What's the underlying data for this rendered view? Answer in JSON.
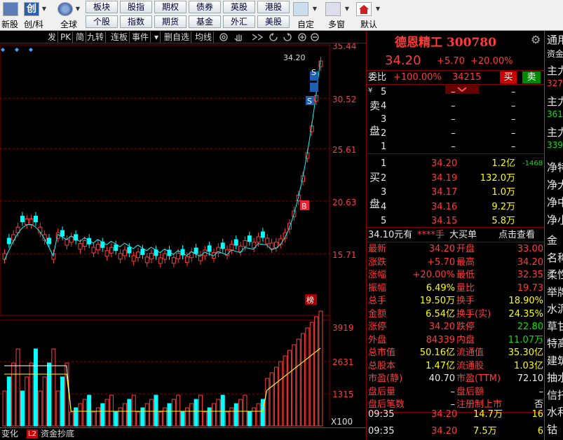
{
  "toolbar": {
    "new_stock": "新股",
    "chuang_ke": "创/科",
    "global": "全球",
    "customize": "自定",
    "multi_window": "多窗",
    "default": "默认",
    "quick_buttons": [
      "板块",
      "股指",
      "期权",
      "债券",
      "英股",
      "港股",
      "个股",
      "指数",
      "期货",
      "基金",
      "外汇",
      "美股"
    ]
  },
  "chart_tabs": [
    "发",
    "PK",
    "简",
    "九转",
    "连板",
    "事件",
    "▾",
    "删自选",
    "均线"
  ],
  "chart": {
    "price_axis": [
      "35.44",
      "30.52",
      "25.61",
      "20.63",
      "15.71"
    ],
    "volume_axis": [
      "3919",
      "2631",
      "1315"
    ],
    "volume_unit": "X100",
    "last_price_tag": "34.20",
    "rank_label": "榜",
    "marker_s": "S",
    "marker_b": "B",
    "colors": {
      "up": "#ff3b3b",
      "down": "#00ffff",
      "ma1": "#ffffff",
      "ma2": "#ffff00",
      "ma3": "#00ffff"
    }
  },
  "bottom_tabs": [
    "变化",
    "L2",
    "资金抄底"
  ],
  "quote": {
    "name": "德恩精工",
    "code": "300780",
    "price": "34.20",
    "change": "+5.70",
    "change_pct": "+20.00%",
    "ratio_label": "委比",
    "ratio": "+100.00%",
    "ratio_vol": "34215",
    "buy_btn": "买",
    "sell_btn": "卖",
    "sell_side_label": [
      "卖",
      "盘"
    ],
    "buy_side_label": [
      "买",
      "盘"
    ],
    "sell_orders": [
      {
        "level": "5",
        "price": "–",
        "vol": "–"
      },
      {
        "level": "4",
        "price": "–",
        "vol": "–"
      },
      {
        "level": "3",
        "price": "–",
        "vol": "–"
      },
      {
        "level": "2",
        "price": "–",
        "vol": "–"
      },
      {
        "level": "1",
        "price": "–",
        "vol": "–"
      }
    ],
    "buy_orders": [
      {
        "level": "1",
        "price": "34.20",
        "vol": "1.2亿",
        "delta": "-1468"
      },
      {
        "level": "2",
        "price": "34.19",
        "vol": "132.0万",
        "delta": ""
      },
      {
        "level": "3",
        "price": "34.17",
        "vol": "1.0万",
        "delta": ""
      },
      {
        "level": "4",
        "price": "34.16",
        "vol": "9.2万",
        "delta": ""
      },
      {
        "level": "5",
        "price": "34.15",
        "vol": "5.8万",
        "delta": ""
      }
    ],
    "bigorder": {
      "price": "34.10元有",
      "hands": "****手",
      "label": "大买单",
      "link": "点击查看"
    },
    "stats_left": [
      {
        "k": "最新",
        "v": "34.20",
        "c": "red"
      },
      {
        "k": "涨跌",
        "v": "+5.70",
        "c": "red"
      },
      {
        "k": "涨幅",
        "v": "+20.00%",
        "c": "red"
      },
      {
        "k": "振幅",
        "v": "6.49%",
        "c": "yellow"
      },
      {
        "k": "总手",
        "v": "19.50万",
        "c": "yellow"
      },
      {
        "k": "金额",
        "v": "6.54亿",
        "c": "yellow"
      },
      {
        "k": "涨停",
        "v": "34.20",
        "c": "red"
      },
      {
        "k": "外盘",
        "v": "84339",
        "c": "red"
      },
      {
        "k": "总市值",
        "v": "50.16亿",
        "c": "yellow"
      },
      {
        "k": "总股本",
        "v": "1.47亿",
        "c": "yellow"
      },
      {
        "k": "市盈(静)",
        "v": "40.70",
        "c": "white"
      },
      {
        "k": "盘后量",
        "v": "–",
        "c": "white"
      },
      {
        "k": "盘后笔数",
        "v": "–",
        "c": "white"
      }
    ],
    "stats_right": [
      {
        "k": "开盘",
        "v": "33.00",
        "c": "red"
      },
      {
        "k": "最高",
        "v": "34.20",
        "c": "red"
      },
      {
        "k": "最低",
        "v": "32.35",
        "c": "red"
      },
      {
        "k": "量比",
        "v": "19.73",
        "c": "red"
      },
      {
        "k": "换手",
        "v": "18.90%",
        "c": "yellow"
      },
      {
        "k": "换手(实)",
        "v": "24.35%",
        "c": "yellow"
      },
      {
        "k": "跌停",
        "v": "22.80",
        "c": "green"
      },
      {
        "k": "内盘",
        "v": "11.07万",
        "c": "green"
      },
      {
        "k": "流通值",
        "v": "35.30亿",
        "c": "yellow"
      },
      {
        "k": "流通股",
        "v": "1.03亿",
        "c": "yellow"
      },
      {
        "k": "市盈(TTM)",
        "v": "72.10",
        "c": "white"
      },
      {
        "k": "盘后额",
        "v": "–",
        "c": "white"
      },
      {
        "k": "注册制上市",
        "v": "否",
        "c": "white"
      }
    ],
    "ticks": [
      {
        "time": "09:35",
        "price": "34.20",
        "vol": "14.7万",
        "n": "16"
      },
      {
        "time": "09:35",
        "price": "34.20",
        "vol": "7.5万",
        "n": "6"
      }
    ]
  },
  "far_right": {
    "top": [
      "通用",
      "资金",
      "主力",
      "327",
      "主力",
      "361",
      "主力",
      "339"
    ],
    "mid": [
      "净特",
      "净大",
      "净中",
      "净小"
    ],
    "list": [
      "金",
      "名称",
      "柔性",
      "举牌",
      "水泥",
      "草甘",
      "特高",
      "建筑",
      "抽水",
      "信托",
      "水利",
      "钴"
    ]
  }
}
